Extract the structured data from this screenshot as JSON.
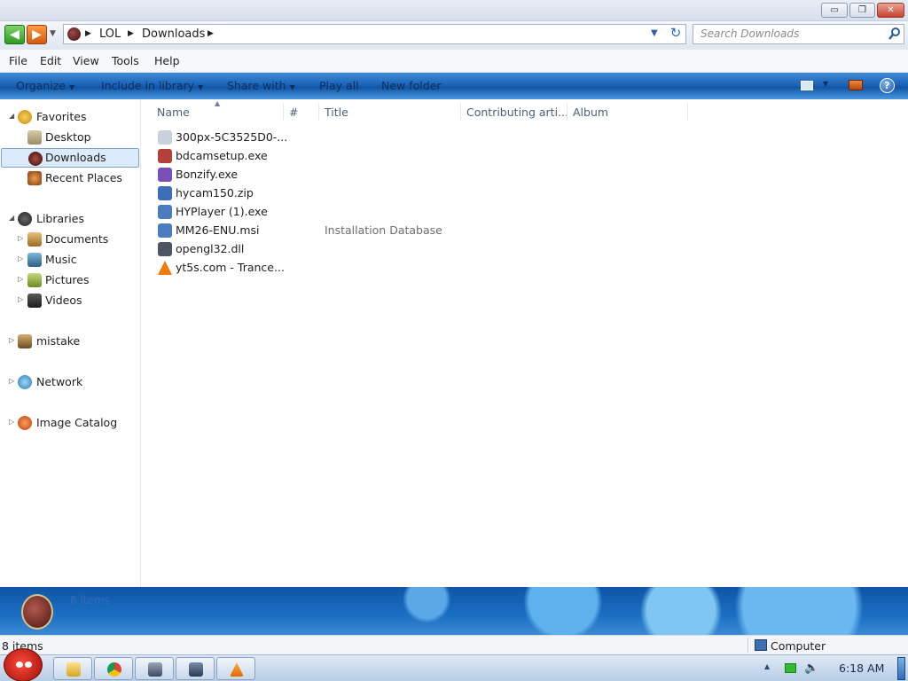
{
  "window": {
    "controls": {
      "minimize": "▭",
      "maximize": "❐",
      "close": "✕"
    }
  },
  "navigation": {
    "breadcrumbs": [
      "LOL",
      "Downloads"
    ],
    "search_placeholder": "Search Downloads"
  },
  "menu": [
    "File",
    "Edit",
    "View",
    "Tools",
    "Help"
  ],
  "commands": {
    "organize": "Organize",
    "include_in_library": "Include in library",
    "share_with": "Share with",
    "play_all": "Play all",
    "new_folder": "New folder"
  },
  "sidebar": {
    "favorites": {
      "label": "Favorites",
      "items": [
        "Desktop",
        "Downloads",
        "Recent Places"
      ]
    },
    "libraries": {
      "label": "Libraries",
      "items": [
        "Documents",
        "Music",
        "Pictures",
        "Videos"
      ]
    },
    "other": [
      "mistake",
      "Network",
      "Image Catalog"
    ],
    "selected": "Downloads"
  },
  "columns": [
    "Name",
    "#",
    "Title",
    "Contributing arti...",
    "Album"
  ],
  "files": [
    {
      "name": "300px-5C3525D0-...",
      "title": "",
      "icon": "image-file-icon",
      "color": "#c9d2dc"
    },
    {
      "name": "bdcamsetup.exe",
      "title": "",
      "icon": "bandicam-icon",
      "color": "#b2413a"
    },
    {
      "name": "Bonzify.exe",
      "title": "",
      "icon": "bonzi-icon",
      "color": "#7a4fb8"
    },
    {
      "name": "hycam150.zip",
      "title": "",
      "icon": "zip-file-icon",
      "color": "#3c6fb5"
    },
    {
      "name": "HYPlayer (1).exe",
      "title": "",
      "icon": "installer-icon",
      "color": "#4a7cc0"
    },
    {
      "name": "MM26-ENU.msi",
      "title": "Installation Database",
      "icon": "msi-file-icon",
      "color": "#4a7cc0"
    },
    {
      "name": "opengl32.dll",
      "title": "",
      "icon": "dll-file-icon",
      "color": "#4d5563"
    },
    {
      "name": "yt5s.com - Trance...",
      "title": "",
      "icon": "vlc-icon",
      "color": "#f07d0a"
    }
  ],
  "details": {
    "count": "8 items"
  },
  "status": {
    "count": "8 items",
    "location": "Computer"
  },
  "taskbar": {
    "clock": "6:18 AM"
  },
  "colors": {
    "accent": "#1b63b6",
    "selection": "#dcebfc"
  }
}
